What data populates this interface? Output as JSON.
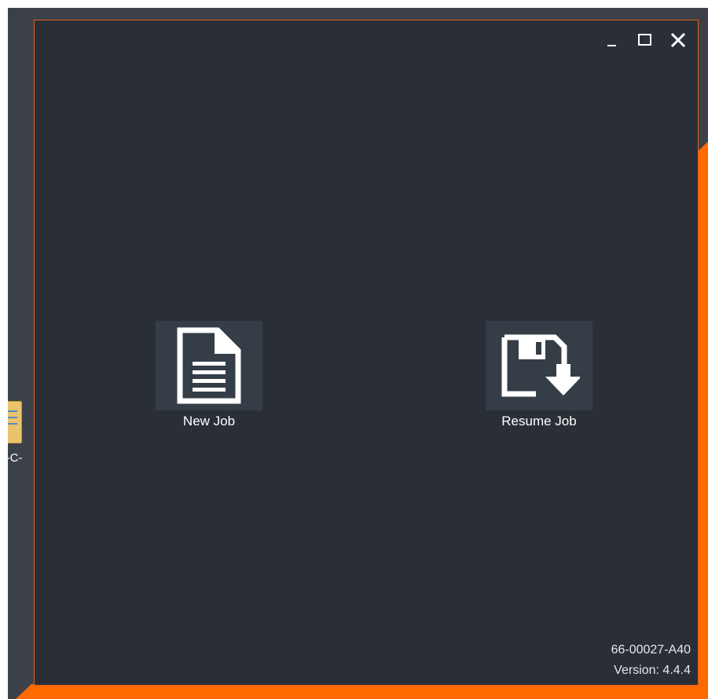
{
  "window": {
    "controls": {
      "minimize_icon": "minimize-icon",
      "maximize_icon": "maximize-icon",
      "close_icon": "close-icon"
    }
  },
  "actions": [
    {
      "label": "New Job",
      "icon": "document-icon"
    },
    {
      "label": "Resume Job",
      "icon": "floppy-download-icon"
    }
  ],
  "footer": {
    "part_number": "66-00027-A40",
    "version": "Version: 4.4.4"
  },
  "desktop": {
    "icon_label": "G-C-\nit"
  },
  "colors": {
    "window_bg": "#2a2f37",
    "tile_bg": "#353d47",
    "accent": "#ff6a00",
    "desktop_bg": "#3c4149"
  }
}
